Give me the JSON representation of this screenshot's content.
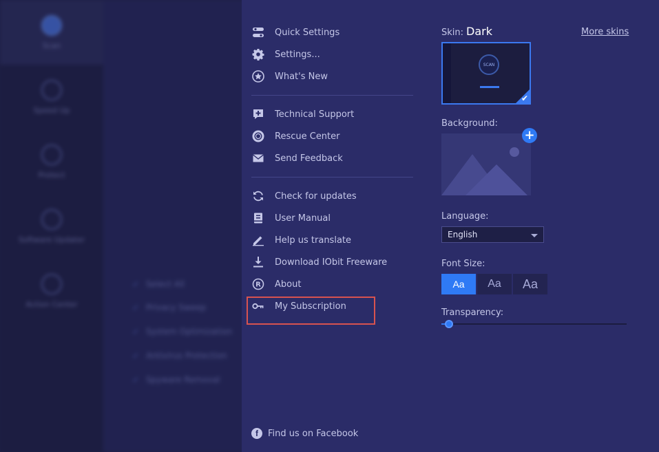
{
  "background_app": {
    "sidebar": [
      {
        "label": "Scan",
        "active": true
      },
      {
        "label": "Speed Up",
        "active": false
      },
      {
        "label": "Protect",
        "active": false
      },
      {
        "label": "Software Updater",
        "active": false
      },
      {
        "label": "Action Center",
        "active": false
      }
    ],
    "checklist": [
      "Select All",
      "Privacy Sweep",
      "System Optimization",
      "Antivirus Protection",
      "Spyware Removal"
    ]
  },
  "menu": {
    "group1": [
      {
        "label": "Quick Settings",
        "icon": "toggle-icon"
      },
      {
        "label": "Settings...",
        "icon": "gear-icon"
      },
      {
        "label": "What's New",
        "icon": "star-icon"
      }
    ],
    "group2": [
      {
        "label": "Technical Support",
        "icon": "support-plus-icon"
      },
      {
        "label": "Rescue Center",
        "icon": "lifebuoy-icon"
      },
      {
        "label": "Send Feedback",
        "icon": "envelope-icon"
      }
    ],
    "group3": [
      {
        "label": "Check for updates",
        "icon": "refresh-icon"
      },
      {
        "label": "User Manual",
        "icon": "manual-icon"
      },
      {
        "label": "Help us translate",
        "icon": "pencil-icon"
      },
      {
        "label": "Download IObit Freeware",
        "icon": "download-icon"
      },
      {
        "label": "About",
        "icon": "registered-icon"
      },
      {
        "label": "My Subscription",
        "icon": "key-icon",
        "highlighted": true
      }
    ],
    "facebook_label": "Find us on Facebook"
  },
  "settings": {
    "skin_label": "Skin:",
    "skin_value": "Dark",
    "more_skins": "More skins",
    "skin_preview_text": "SCAN",
    "background_label": "Background:",
    "language_label": "Language:",
    "language_value": "English",
    "font_size_label": "Font Size:",
    "font_sizes": [
      "Aa",
      "Aa",
      "Aa"
    ],
    "font_size_selected": 0,
    "transparency_label": "Transparency:",
    "transparency_value": 0.04
  },
  "colors": {
    "accent": "#2f7af5",
    "panel": "#2b2c68",
    "highlight": "#d9534f"
  }
}
